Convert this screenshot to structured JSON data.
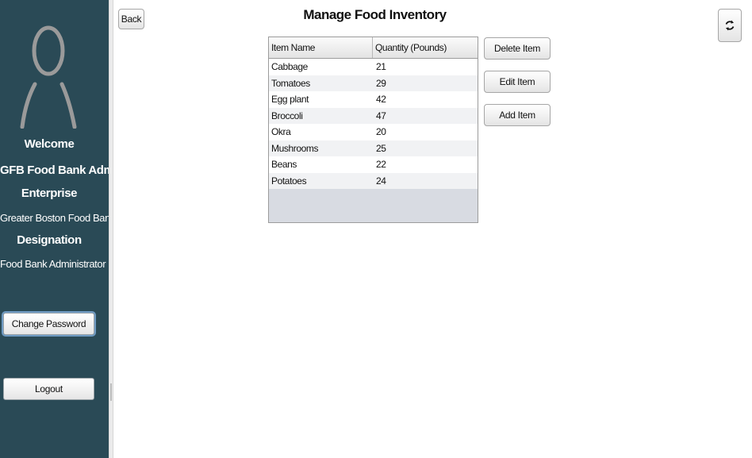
{
  "sidebar": {
    "welcome": "Welcome",
    "user_name": "GFB Food Bank Admin",
    "enterprise_label": "Enterprise",
    "enterprise_value": "Greater Boston Food Bank",
    "designation_label": "Designation",
    "designation_value": "Food Bank Administrator",
    "change_password": "Change Password",
    "logout": "Logout"
  },
  "toolbar": {
    "back": "Back",
    "refresh_icon": "refresh-icon"
  },
  "page": {
    "title": "Manage Food Inventory"
  },
  "table": {
    "columns": [
      "Item Name",
      "Quantity (Pounds)"
    ],
    "rows": [
      {
        "name": "Cabbage",
        "qty": "21"
      },
      {
        "name": "Tomatoes",
        "qty": "29"
      },
      {
        "name": "Egg plant",
        "qty": "42"
      },
      {
        "name": "Broccoli",
        "qty": "47"
      },
      {
        "name": "Okra",
        "qty": "20"
      },
      {
        "name": "Mushrooms",
        "qty": "25"
      },
      {
        "name": "Beans",
        "qty": "22"
      },
      {
        "name": "Potatoes",
        "qty": "24"
      }
    ]
  },
  "actions": {
    "delete": "Delete Item",
    "edit": "Edit Item",
    "add": "Add Item"
  },
  "colors": {
    "sidebar_bg": "#2a4a56",
    "avatar_gray": "#9a9a9a"
  }
}
